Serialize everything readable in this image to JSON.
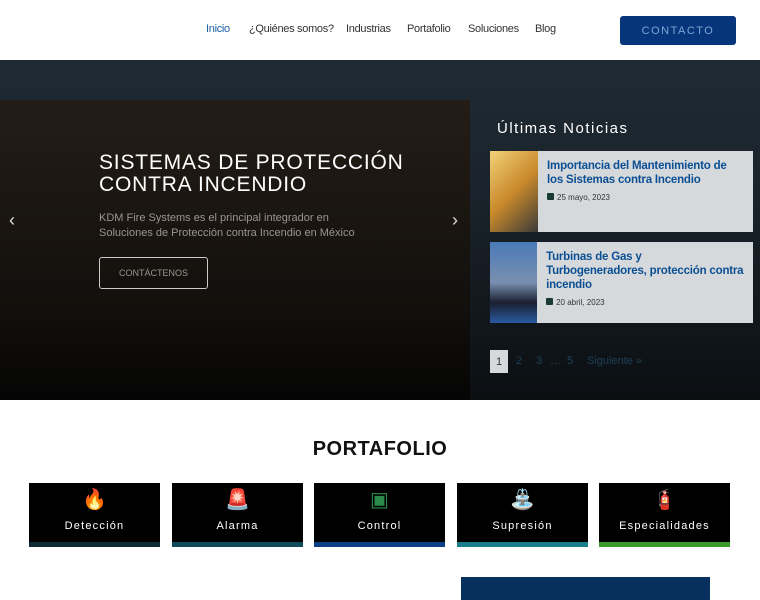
{
  "nav": {
    "items": [
      "Inicio",
      "¿Quiénes somos?",
      "Industrias",
      "Portafolio",
      "Soluciones",
      "Blog"
    ],
    "cta": "CONTACTO"
  },
  "hero": {
    "title": "SISTEMAS DE PROTECCIÓN CONTRA INCENDIO",
    "subtitle": "KDM Fire Systems es el principal integrador en Soluciones de Protección contra Incendio en México",
    "button": "CONTÁCTENOS",
    "prev": "‹",
    "next": "›"
  },
  "news": {
    "title": "Últimas Noticias",
    "items": [
      {
        "title": "Importancia del Mantenimiento de los Sistemas contra Incendio",
        "date": "25 mayo, 2023"
      },
      {
        "title": "Turbinas de Gas y Turbogeneradores, protección contra incendio",
        "date": "20 abril, 2023"
      }
    ],
    "pages": [
      "1",
      "2",
      "3",
      "…",
      "5",
      "Siguiente »"
    ]
  },
  "portfolio": {
    "title": "PORTAFOLIO",
    "items": [
      {
        "label": "Detección",
        "icon": "🔥",
        "color": "#0e2a33"
      },
      {
        "label": "Alarma",
        "icon": "🚨",
        "color": "#0f4a5a"
      },
      {
        "label": "Control",
        "icon": "▣",
        "color": "#0d3f86"
      },
      {
        "label": "Supresión",
        "icon": "⛲",
        "color": "#1a7e8a"
      },
      {
        "label": "Especialidades",
        "icon": "🧯",
        "color": "#3a9a2a"
      }
    ]
  }
}
